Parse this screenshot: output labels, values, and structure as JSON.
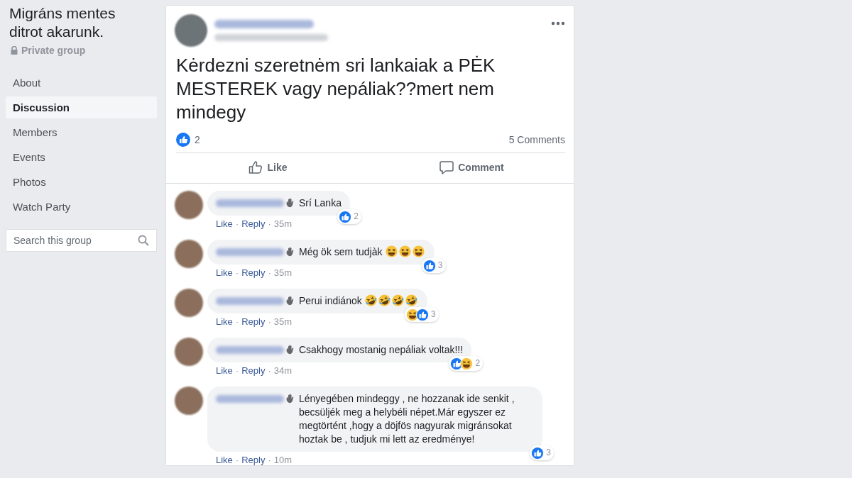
{
  "group": {
    "title": "Migráns mentes ditrot akarunk.",
    "privacy": "Private group"
  },
  "nav": [
    {
      "label": "About",
      "selected": false
    },
    {
      "label": "Discussion",
      "selected": true
    },
    {
      "label": "Members",
      "selected": false
    },
    {
      "label": "Events",
      "selected": false
    },
    {
      "label": "Photos",
      "selected": false
    },
    {
      "label": "Watch Party",
      "selected": false
    }
  ],
  "search": {
    "placeholder": "Search this group"
  },
  "post": {
    "text": "Kėrdezni szeretnėm sri lankaiak a PĖK MESTEREK vagy nepáliak??mert nem mindegy",
    "reaction_count": "2",
    "comments_count": "5 Comments",
    "actions": [
      {
        "kind": "like",
        "label": "Like"
      },
      {
        "kind": "comment",
        "label": "Comment"
      }
    ]
  },
  "comments": [
    {
      "text": "Srí Lanka",
      "reactions": [
        {
          "kind": "like"
        }
      ],
      "reaction_count": "2",
      "like": "Like",
      "separator": "·",
      "reply": "Reply",
      "time": "35m"
    },
    {
      "text": "Még ök sem tudjàk",
      "emojis": [
        {
          "kind": "grin"
        },
        {
          "kind": "grin"
        },
        {
          "kind": "grin"
        }
      ],
      "reactions": [
        {
          "kind": "like"
        }
      ],
      "reaction_count": "3",
      "like": "Like",
      "separator": "·",
      "reply": "Reply",
      "time": "35m"
    },
    {
      "text": "Perui indiánok",
      "emojis": [
        {
          "kind": "rofl"
        },
        {
          "kind": "rofl"
        },
        {
          "kind": "rofl"
        },
        {
          "kind": "rofl"
        }
      ],
      "reactions": [
        {
          "kind": "haha"
        },
        {
          "kind": "like"
        }
      ],
      "reaction_count": "3",
      "like": "Like",
      "separator": "·",
      "reply": "Reply",
      "time": "35m"
    },
    {
      "text": "Csakhogy mostanig nepáliak voltak!!!",
      "reactions": [
        {
          "kind": "like"
        },
        {
          "kind": "haha"
        }
      ],
      "reaction_count": "2",
      "like": "Like",
      "separator": "·",
      "reply": "Reply",
      "time": "34m"
    },
    {
      "text": "Lényegében mindeggy , ne hozzanak ide senkit , becsüljék meg a helybéli népet.Már egyszer ez megtörtént ,hogy a döjfös nagyurak migránsokat hoztak be , tudjuk mi lett az eredménye!",
      "reactions": [
        {
          "kind": "like"
        }
      ],
      "reaction_count": "3",
      "like": "Like",
      "separator": "·",
      "reply": "Reply",
      "time": "10m"
    }
  ]
}
